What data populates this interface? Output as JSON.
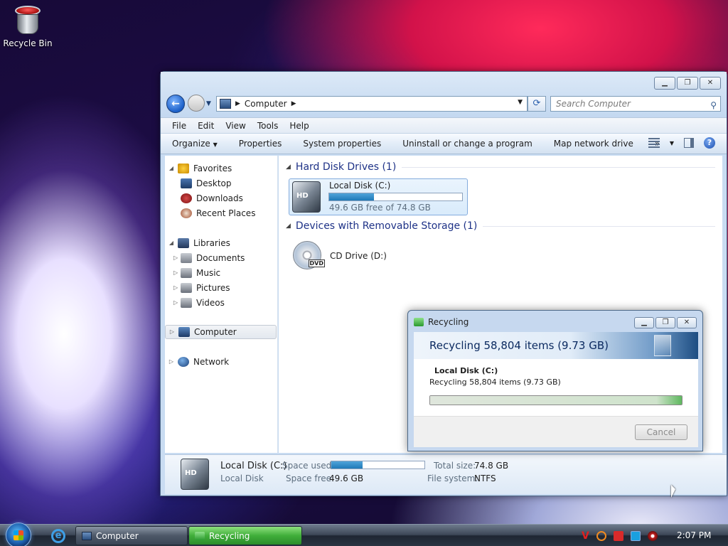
{
  "desktop": {
    "recycle_bin_label": "Recycle Bin"
  },
  "explorer": {
    "address": {
      "segments": [
        "Computer"
      ]
    },
    "search": {
      "placeholder": "Search Computer"
    },
    "menu": [
      "File",
      "Edit",
      "View",
      "Tools",
      "Help"
    ],
    "toolbar": {
      "organize": "Organize",
      "properties": "Properties",
      "system_properties": "System properties",
      "uninstall": "Uninstall or change a program",
      "map_drive": "Map network drive",
      "more": "»"
    },
    "nav": {
      "favorites": "Favorites",
      "desktop": "Desktop",
      "downloads": "Downloads",
      "recent": "Recent Places",
      "libraries": "Libraries",
      "documents": "Documents",
      "music": "Music",
      "pictures": "Pictures",
      "videos": "Videos",
      "computer": "Computer",
      "network": "Network"
    },
    "groups": {
      "hard_disk": "Hard Disk Drives (1)",
      "removable": "Devices with Removable Storage (1)"
    },
    "drive_c": {
      "name": "Local Disk (C:)",
      "free_text": "49.6 GB free of 74.8 GB",
      "used_fraction": 0.337
    },
    "drive_d": {
      "name": "CD Drive (D:)"
    },
    "details": {
      "name": "Local Disk (C:)",
      "type": "Local Disk",
      "space_used_label": "Space used:",
      "space_free_label": "Space free:",
      "space_free_value": "49.6 GB",
      "total_label": "Total size:",
      "total_value": "74.8 GB",
      "fs_label": "File system:",
      "fs_value": "NTFS"
    }
  },
  "dialog": {
    "title": "Recycling",
    "header": "Recycling 58,804 items (9.73 GB)",
    "source": "Local Disk (C:)",
    "status": "Recycling 58,804 items (9.73 GB)",
    "progress_fraction": 1.0,
    "cancel": "Cancel"
  },
  "taskbar": {
    "computer": "Computer",
    "recycling": "Recycling",
    "clock": "2:07 PM"
  },
  "colors": {
    "accent_blue": "#1e3287",
    "progress_green": "#5fb85f",
    "active_task": "#3fae3a"
  }
}
